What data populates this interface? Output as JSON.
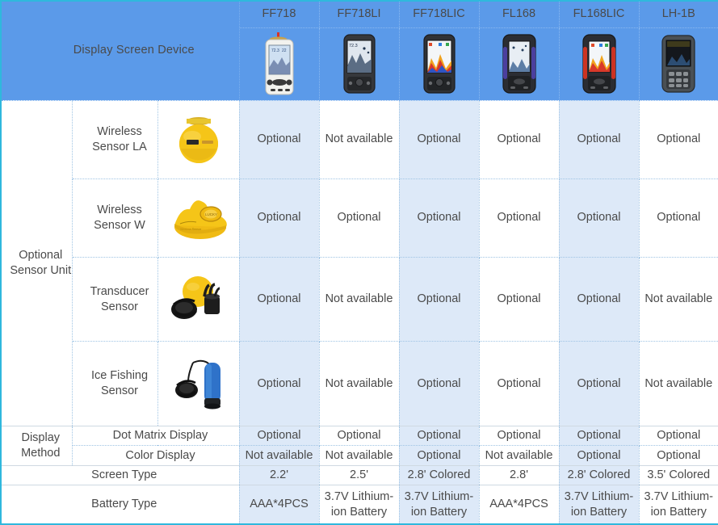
{
  "header": {
    "brand_title": "Display Screen Device",
    "models": [
      {
        "name": "FF718",
        "icon": "fishfinder-ff718-photo"
      },
      {
        "name": "FF718LI",
        "icon": "fishfinder-ff718li-photo"
      },
      {
        "name": "FF718LIC",
        "icon": "fishfinder-ff718lic-photo"
      },
      {
        "name": "FL168",
        "icon": "fishfinder-fl168-photo"
      },
      {
        "name": "FL168LIC",
        "icon": "fishfinder-fl168lic-photo"
      },
      {
        "name": "LH-1B",
        "icon": "fishfinder-lh1b-photo"
      }
    ]
  },
  "colors": {
    "header_blue": "#5b9ae9",
    "stripe_blue": "#dde9f8",
    "table_border": "#2fb8dd",
    "grid_dotted": "#9fc4e4",
    "text_gray": "#4a4a4a"
  },
  "groups": [
    {
      "label": "Optional Sensor Unit",
      "rows": [
        {
          "sub_label": "Wireless Sensor LA",
          "image": "wireless-sensor-la-photo",
          "values": [
            "Optional",
            "Not available",
            "Optional",
            "Optional",
            "Optional",
            "Optional"
          ]
        },
        {
          "sub_label": "Wireless Sensor W",
          "image": "wireless-sensor-w-photo",
          "values": [
            "Optional",
            "Optional",
            "Optional",
            "Optional",
            "Optional",
            "Optional"
          ]
        },
        {
          "sub_label": "Transducer Sensor",
          "image": "transducer-sensor-photo",
          "values": [
            "Optional",
            "Not available",
            "Optional",
            "Optional",
            "Optional",
            "Not available"
          ]
        },
        {
          "sub_label": "Ice Fishing Sensor",
          "image": "ice-fishing-sensor-photo",
          "values": [
            "Optional",
            "Not available",
            "Optional",
            "Optional",
            "Optional",
            "Not available"
          ]
        }
      ]
    },
    {
      "label": "Display Method",
      "rows": [
        {
          "sub_label": "Dot Matrix Display",
          "image": null,
          "values": [
            "Optional",
            "Optional",
            "Optional",
            "Optional",
            "Optional",
            "Optional"
          ]
        },
        {
          "sub_label": "Color Display",
          "image": null,
          "values": [
            "Not available",
            "Not available",
            "Optional",
            "Not available",
            "Optional",
            "Optional"
          ]
        }
      ]
    }
  ],
  "simple_rows": [
    {
      "label": "Screen Type",
      "values": [
        "2.2'",
        "2.5'",
        "2.8' Colored",
        "2.8'",
        "2.8' Colored",
        "3.5' Colored"
      ]
    },
    {
      "label": "Battery Type",
      "values": [
        "AAA*4PCS",
        "3.7V Lithium-ion Battery",
        "3.7V Lithium-ion Battery",
        "AAA*4PCS",
        "3.7V Lithium-ion Battery",
        "3.7V Lithium-ion Battery"
      ]
    }
  ]
}
